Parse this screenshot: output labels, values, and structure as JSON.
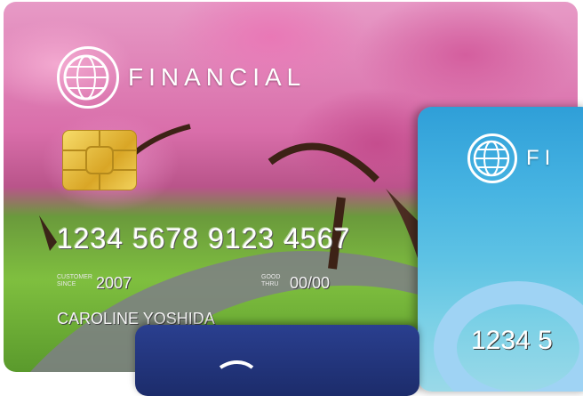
{
  "main_card": {
    "brand": "FINANCIAL",
    "number": "1234 5678 9123 4567",
    "customer_since_label": "CUSTOMER SINCE",
    "customer_since_value": "2007",
    "good_thru_label": "GOOD THRU",
    "good_thru_value": "00/00",
    "cardholder": "CAROLINE YOSHIDA"
  },
  "right_card": {
    "brand": "FI",
    "number": "1234 5"
  }
}
